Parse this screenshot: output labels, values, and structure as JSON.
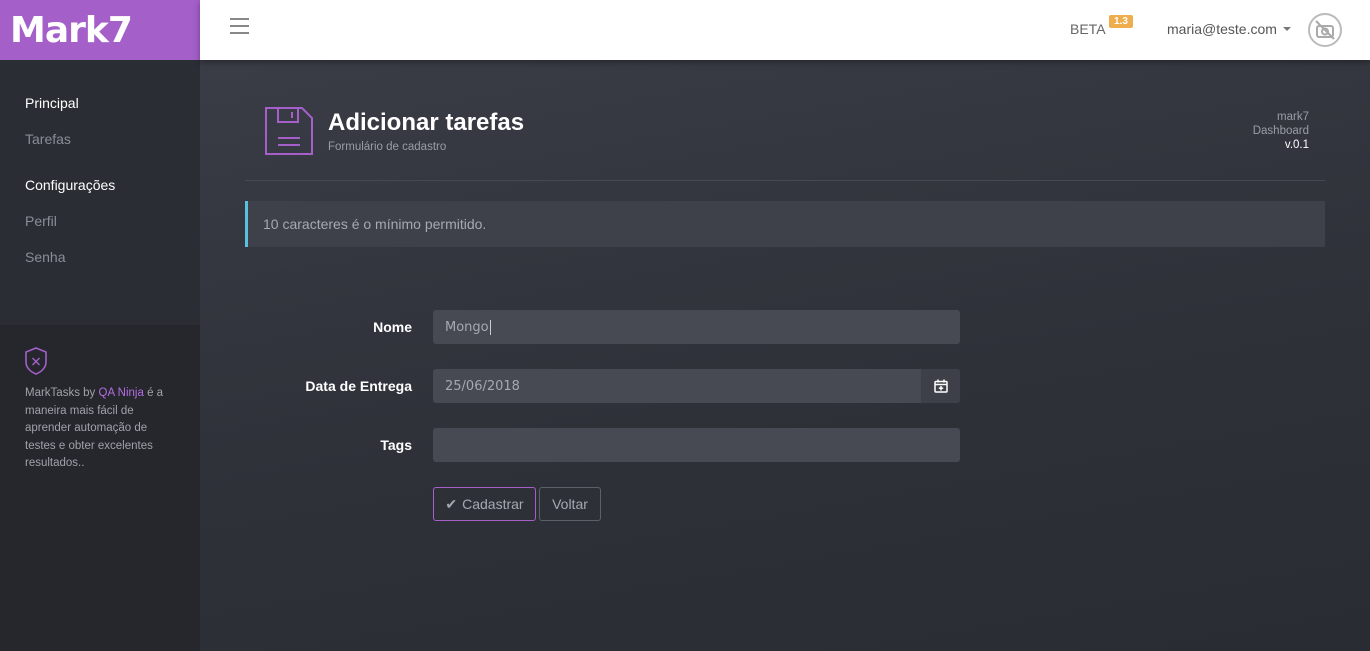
{
  "brand": {
    "name": "Mark7"
  },
  "header": {
    "beta_label": "BETA",
    "version_badge": "1.3",
    "user_email": "maria@teste.com",
    "menu_icon": "hamburger-icon",
    "avatar_icon": "no-photo-icon"
  },
  "sidebar": {
    "sections": [
      {
        "title": "Principal",
        "items": [
          "Tarefas"
        ]
      },
      {
        "title": "Configurações",
        "items": [
          "Perfil",
          "Senha"
        ]
      }
    ],
    "info": {
      "text_before": "MarkTasks by ",
      "link": "QA Ninja",
      "text_after": " é a maneira mais fácil de aprender automação de testes e obter excelentes resultados.."
    }
  },
  "page": {
    "title": "Adicionar tarefas",
    "subtitle": "Formulário de cadastro",
    "meta_app": "mark7",
    "meta_section": "Dashboard",
    "meta_version": "v.0.1"
  },
  "alert": {
    "message": "10 caracteres é o mínimo permitido."
  },
  "form": {
    "name_label": "Nome",
    "name_value": "Mongo",
    "date_label": "Data de Entrega",
    "date_value": "25/06/2018",
    "tags_label": "Tags",
    "tags_value": "",
    "submit_label": "Cadastrar",
    "back_label": "Voltar"
  },
  "colors": {
    "brand": "#a45fc9",
    "alert_accent": "#5bc0de",
    "badge": "#f0ad4e"
  }
}
